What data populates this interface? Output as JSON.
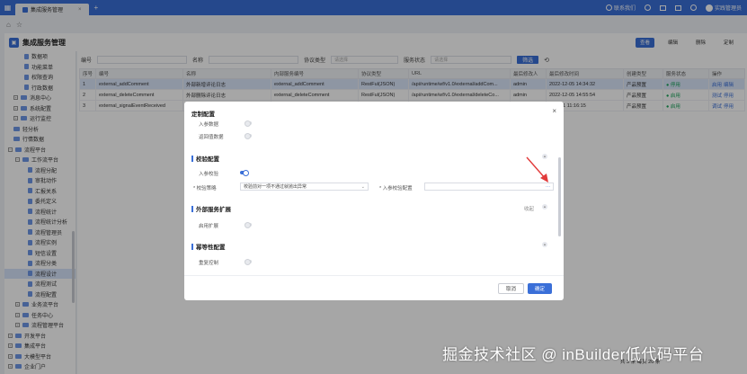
{
  "topbar": {
    "tab_label": "集成服务管理",
    "tab_close": "×",
    "plus": "+",
    "contact": "联系我们",
    "user": "实践管理员"
  },
  "breadcrumb": {
    "home_icon": "home-icon",
    "star_icon": "star-icon"
  },
  "page": {
    "title": "集成服务管理",
    "actions": [
      "查看",
      "编辑",
      "删除",
      "定制"
    ]
  },
  "sidebar": {
    "items": [
      {
        "label": "数据项",
        "indent": 22,
        "kind": "doc"
      },
      {
        "label": "功能菜单",
        "indent": 22,
        "kind": "doc"
      },
      {
        "label": "权限查询",
        "indent": 22,
        "kind": "doc"
      },
      {
        "label": "行政数据",
        "indent": 22,
        "kind": "doc"
      },
      {
        "label": "消息中心",
        "indent": 10,
        "kind": "fold",
        "exp": "+"
      },
      {
        "label": "系统配置",
        "indent": 10,
        "kind": "fold",
        "exp": "+"
      },
      {
        "label": "运行监控",
        "indent": 10,
        "kind": "fold",
        "exp": "+"
      },
      {
        "label": "轻分析",
        "indent": 10,
        "kind": "fold"
      },
      {
        "label": "行情数据",
        "indent": 10,
        "kind": "fold"
      },
      {
        "label": "流程平台",
        "indent": 4,
        "kind": "fold",
        "exp": "−"
      },
      {
        "label": "工作流平台",
        "indent": 12,
        "kind": "fold",
        "exp": "−"
      },
      {
        "label": "流程分配",
        "indent": 26,
        "kind": "doc"
      },
      {
        "label": "审批动作",
        "indent": 26,
        "kind": "doc"
      },
      {
        "label": "汇报关系",
        "indent": 26,
        "kind": "doc"
      },
      {
        "label": "委托定义",
        "indent": 26,
        "kind": "doc"
      },
      {
        "label": "流程统计",
        "indent": 26,
        "kind": "doc"
      },
      {
        "label": "流程统计分析",
        "indent": 26,
        "kind": "doc"
      },
      {
        "label": "流程管理员",
        "indent": 26,
        "kind": "doc"
      },
      {
        "label": "流程实例",
        "indent": 26,
        "kind": "doc"
      },
      {
        "label": "短信设置",
        "indent": 26,
        "kind": "doc"
      },
      {
        "label": "流程分类",
        "indent": 26,
        "kind": "doc"
      },
      {
        "label": "流程设计",
        "indent": 26,
        "kind": "doc",
        "active": true
      },
      {
        "label": "流程测试",
        "indent": 26,
        "kind": "doc"
      },
      {
        "label": "流程配置",
        "indent": 26,
        "kind": "doc"
      },
      {
        "label": "业务流平台",
        "indent": 12,
        "kind": "fold",
        "exp": "+"
      },
      {
        "label": "任务中心",
        "indent": 12,
        "kind": "fold",
        "exp": "+"
      },
      {
        "label": "流程管理平台",
        "indent": 12,
        "kind": "fold",
        "exp": "+"
      },
      {
        "label": "开发平台",
        "indent": 4,
        "kind": "fold",
        "exp": "+"
      },
      {
        "label": "集成平台",
        "indent": 4,
        "kind": "fold",
        "exp": "+"
      },
      {
        "label": "大模型平台",
        "indent": 4,
        "kind": "fold",
        "exp": "+"
      },
      {
        "label": "企业门户",
        "indent": 4,
        "kind": "fold",
        "exp": "+"
      }
    ]
  },
  "filter": {
    "code_label": "编号",
    "name_label": "名称",
    "type_label": "协议类型",
    "type_placeholder": "请选择",
    "status_label": "服务状态",
    "status_placeholder": "请选择",
    "query_button": "筛选",
    "reset_icon": "reset-icon"
  },
  "table": {
    "headers": [
      "序号",
      "编号",
      "名称",
      "内部服务编号",
      "协议类型",
      "URL",
      "最后修改人",
      "最后修改时间",
      "创建类型",
      "服务状态",
      "操作"
    ],
    "rows": [
      {
        "no": "1",
        "code": "external_addComment",
        "name": "外部新增评论日志",
        "internal": "external_addComment",
        "protocol": "RestFul(JSON)",
        "url": "/api/runtime/wf/v1.0/external/addCom...",
        "modifier": "admin",
        "time": "2022-12-05 14:34:32",
        "ctype": "产品预置",
        "status": "● 停用",
        "ops": [
          "启用",
          "编辑"
        ],
        "selected": true
      },
      {
        "no": "2",
        "code": "external_deleteComment",
        "name": "外部删除评论日志",
        "internal": "external_deleteComment",
        "protocol": "RestFul(JSON)",
        "url": "/api/runtime/wf/v1.0/external/deleteCo...",
        "modifier": "admin",
        "time": "2022-12-05 14:55:54",
        "ctype": "产品预置",
        "status": "● 启用",
        "ops": [
          "测试",
          "停用"
        ]
      },
      {
        "no": "3",
        "code": "external_signalEventReceived",
        "name": "",
        "internal": "",
        "protocol": "",
        "url": "",
        "modifier": "admin",
        "time": "...01-11 11:16:15",
        "ctype": "产品预置",
        "status": "● 启用",
        "ops": [
          "调试",
          "停用"
        ]
      }
    ]
  },
  "modal": {
    "close": "×",
    "sections": {
      "custom": "定制配置",
      "validation": "校验配置",
      "extension": "外部服务扩展",
      "extension_link": "收起",
      "idempotent": "幂等性配置"
    },
    "fields": {
      "input_data": "入参数据",
      "return_data": "返回值数据",
      "input_check": "入参校验",
      "check_strategy": "校验策略",
      "check_strategy_value": "校验前对一项不通过就抛出异常",
      "input_check_config": "入参校验配置",
      "config_dots": "···",
      "enable_ext": "启用扩展",
      "idempotent_ctrl": "重复控制"
    },
    "cancel": "取消",
    "ok": "确定"
  },
  "pager": {
    "text": "共 3 条     每页 20 条"
  },
  "watermark": "掘金技术社区 @ inBuilder低代码平台",
  "colors": {
    "primary": "#3a6fd8",
    "arrow": "#e23b3b",
    "status_green": "#19a35a"
  }
}
